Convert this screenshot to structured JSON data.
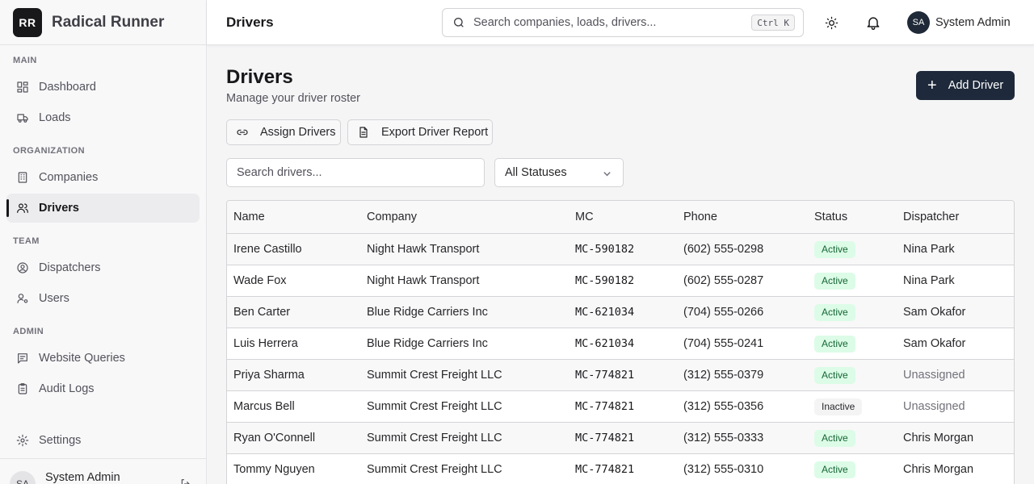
{
  "brand": {
    "logo": "RR",
    "name": "Radical Runner"
  },
  "sidebar": {
    "sections": [
      {
        "title": "MAIN"
      },
      {
        "title": "ORGANIZATION"
      },
      {
        "title": "TEAM"
      },
      {
        "title": "ADMIN"
      }
    ],
    "items": [
      {
        "label": "Dashboard",
        "icon": "dashboard-icon"
      },
      {
        "label": "Loads",
        "icon": "truck-icon"
      },
      {
        "label": "Companies",
        "icon": "building-icon"
      },
      {
        "label": "Drivers",
        "icon": "users-icon",
        "active": true
      },
      {
        "label": "Dispatchers",
        "icon": "user-circle-icon"
      },
      {
        "label": "Users",
        "icon": "user-cog-icon"
      },
      {
        "label": "Website Queries",
        "icon": "message-icon"
      },
      {
        "label": "Audit Logs",
        "icon": "clipboard-icon"
      },
      {
        "label": "Settings",
        "icon": "gear-icon"
      }
    ],
    "footer": {
      "initials": "SA",
      "name": "System Admin"
    }
  },
  "topbar": {
    "title": "Drivers",
    "search_placeholder": "Search companies, loads, drivers...",
    "shortcut": "Ctrl K",
    "user": {
      "initials": "SA",
      "name": "System Admin"
    }
  },
  "page": {
    "title": "Drivers",
    "subtitle": "Manage your driver roster",
    "add_button": "Add Driver",
    "assign_button": "Assign Drivers",
    "export_button": "Export Driver Report",
    "filter_placeholder": "Search drivers...",
    "status_filter": "All Statuses"
  },
  "table": {
    "columns": [
      "Name",
      "Company",
      "MC",
      "Phone",
      "Status",
      "Dispatcher"
    ],
    "rows": [
      {
        "name": "Irene Castillo",
        "company": "Night Hawk Transport",
        "mc": "MC-590182",
        "phone": "(602) 555-0298",
        "status": "Active",
        "dispatcher": "Nina Park"
      },
      {
        "name": "Wade Fox",
        "company": "Night Hawk Transport",
        "mc": "MC-590182",
        "phone": "(602) 555-0287",
        "status": "Active",
        "dispatcher": "Nina Park"
      },
      {
        "name": "Ben Carter",
        "company": "Blue Ridge Carriers Inc",
        "mc": "MC-621034",
        "phone": "(704) 555-0266",
        "status": "Active",
        "dispatcher": "Sam Okafor"
      },
      {
        "name": "Luis Herrera",
        "company": "Blue Ridge Carriers Inc",
        "mc": "MC-621034",
        "phone": "(704) 555-0241",
        "status": "Active",
        "dispatcher": "Sam Okafor"
      },
      {
        "name": "Priya Sharma",
        "company": "Summit Crest Freight LLC",
        "mc": "MC-774821",
        "phone": "(312) 555-0379",
        "status": "Active",
        "dispatcher": "Unassigned"
      },
      {
        "name": "Marcus Bell",
        "company": "Summit Crest Freight LLC",
        "mc": "MC-774821",
        "phone": "(312) 555-0356",
        "status": "Inactive",
        "dispatcher": "Unassigned"
      },
      {
        "name": "Ryan O'Connell",
        "company": "Summit Crest Freight LLC",
        "mc": "MC-774821",
        "phone": "(312) 555-0333",
        "status": "Active",
        "dispatcher": "Chris Morgan"
      },
      {
        "name": "Tommy Nguyen",
        "company": "Summit Crest Freight LLC",
        "mc": "MC-774821",
        "phone": "(312) 555-0310",
        "status": "Active",
        "dispatcher": "Chris Morgan"
      }
    ]
  },
  "colors": {
    "primary": "#1e293b",
    "active_badge_bg": "#dcfce7",
    "active_badge_text": "#166534"
  }
}
